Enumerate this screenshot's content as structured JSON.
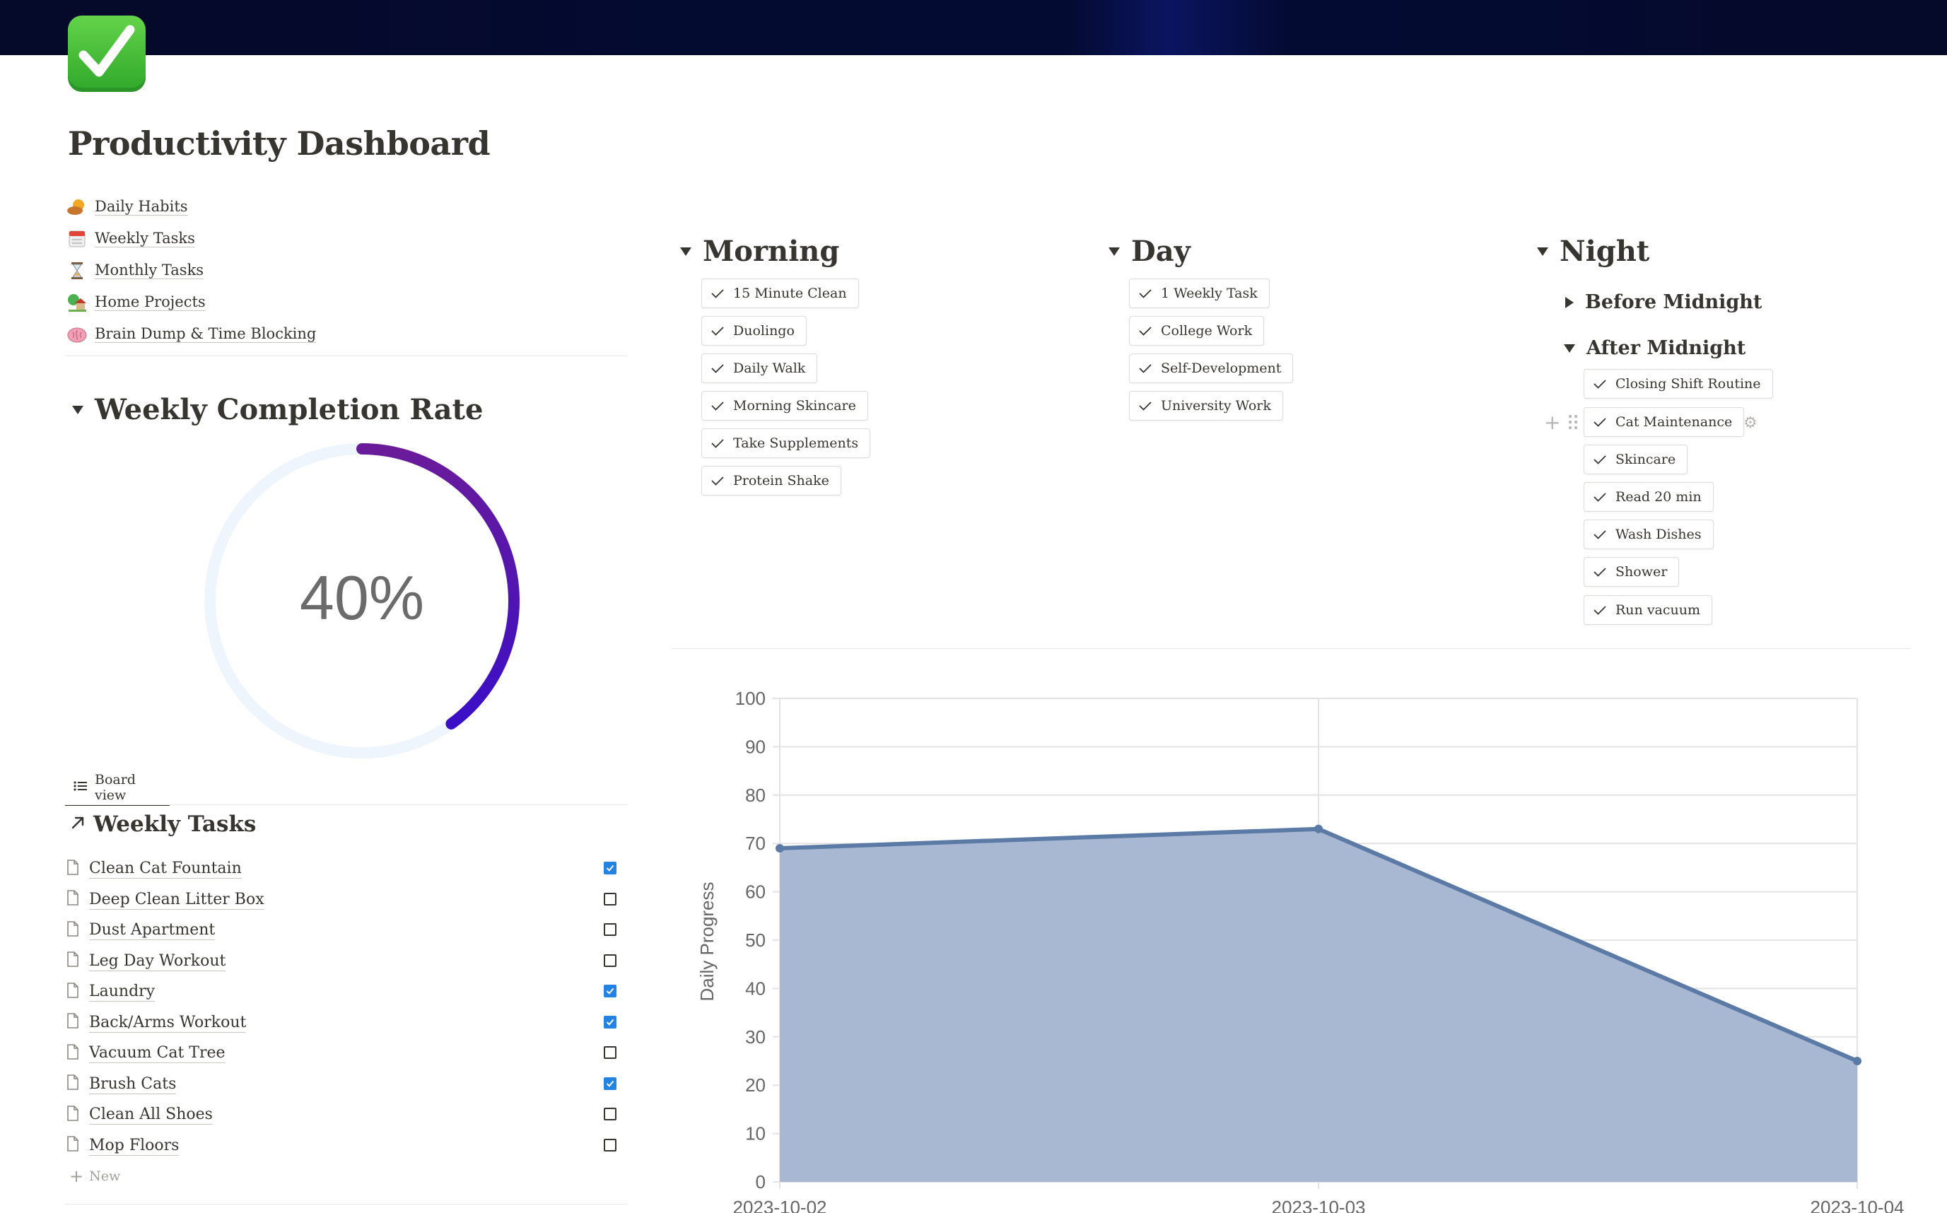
{
  "page": {
    "icon": "check-mark-button-icon",
    "title": "Productivity Dashboard"
  },
  "links": [
    {
      "icon": "sun-behind-cloud-icon",
      "label": "Daily Habits"
    },
    {
      "icon": "calendar-icon",
      "label": "Weekly Tasks"
    },
    {
      "icon": "hourglass-icon",
      "label": "Monthly Tasks"
    },
    {
      "icon": "house-with-garden-icon",
      "label": "Home Projects"
    },
    {
      "icon": "brain-icon",
      "label": "Brain Dump & Time Blocking"
    }
  ],
  "completion": {
    "title": "Weekly Completion Rate",
    "value_label": "40%",
    "fraction": 0.4,
    "colors": {
      "track": "#eff5fc",
      "start": "#6a1b9a",
      "end": "#3a0fc7"
    }
  },
  "board": {
    "view_label": "Board view",
    "title": "Weekly Tasks",
    "tasks": [
      {
        "name": "Clean Cat Fountain",
        "done": true
      },
      {
        "name": "Deep Clean Litter Box",
        "done": false
      },
      {
        "name": "Dust Apartment",
        "done": false
      },
      {
        "name": "Leg Day Workout",
        "done": false
      },
      {
        "name": "Laundry",
        "done": true
      },
      {
        "name": "Back/Arms Workout",
        "done": true
      },
      {
        "name": "Vacuum Cat Tree",
        "done": false
      },
      {
        "name": "Brush Cats",
        "done": true
      },
      {
        "name": "Clean All Shoes",
        "done": false
      },
      {
        "name": "Mop Floors",
        "done": false
      }
    ],
    "new_label": "New"
  },
  "routines": {
    "morning": {
      "title": "Morning",
      "buttons": [
        "15 Minute Clean",
        "Duolingo",
        "Daily Walk",
        "Morning Skincare",
        "Take Supplements",
        "Protein Shake"
      ]
    },
    "day": {
      "title": "Day",
      "buttons": [
        "1 Weekly Task",
        "College Work",
        "Self-Development",
        "University Work"
      ]
    },
    "night": {
      "title": "Night",
      "before_midnight": {
        "title": "Before Midnight"
      },
      "after_midnight": {
        "title": "After Midnight",
        "buttons": [
          "Closing Shift Routine",
          "Cat Maintenance",
          "Skincare",
          "Read 20 min",
          "Wash Dishes",
          "Shower",
          "Run vacuum"
        ]
      }
    }
  },
  "chart_data": {
    "type": "area",
    "x": [
      "2023-10-02",
      "2023-10-03",
      "2023-10-04"
    ],
    "series": [
      {
        "values": [
          69,
          73,
          25
        ]
      }
    ],
    "ylabel": "Daily Progress",
    "xlabel": "",
    "ylim": [
      0,
      100
    ],
    "yticks": [
      "0",
      "10",
      "20",
      "30",
      "40",
      "50",
      "60",
      "70",
      "80",
      "90",
      "100"
    ],
    "grid": true,
    "colors": {
      "line": "#5b7aa6",
      "fill": "#a8b8d3"
    }
  }
}
